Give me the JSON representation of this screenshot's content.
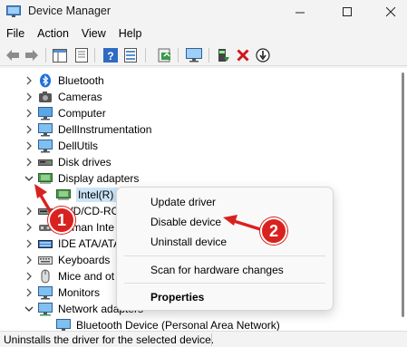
{
  "window": {
    "title": "Device Manager",
    "minimize_glyph": "—",
    "maximize_glyph": "☐",
    "close_glyph": "✕"
  },
  "menu": [
    "File",
    "Action",
    "View",
    "Help"
  ],
  "toolbar": {
    "icons": [
      "back-icon",
      "forward-icon",
      "show-hide-tree-icon",
      "properties-icon",
      "help-icon",
      "scan-hardware-icon",
      "monitor-icon",
      "update-driver-icon",
      "uninstall-icon",
      "disable-icon"
    ]
  },
  "tree": {
    "items": [
      {
        "label": "Bluetooth",
        "icon": "bluetooth-icon",
        "expanded": false
      },
      {
        "label": "Cameras",
        "icon": "camera-icon",
        "expanded": false
      },
      {
        "label": "Computer",
        "icon": "computer-icon",
        "expanded": false
      },
      {
        "label": "DellInstrumentation",
        "icon": "monitor-icon",
        "expanded": false
      },
      {
        "label": "DellUtils",
        "icon": "monitor-icon",
        "expanded": false
      },
      {
        "label": "Disk drives",
        "icon": "disk-drive-icon",
        "expanded": false
      },
      {
        "label": "Display adapters",
        "icon": "display-adapter-icon",
        "expanded": true
      },
      {
        "label": "Intel(R) H",
        "icon": "display-adapter-icon",
        "child": true,
        "selected": true
      },
      {
        "label": "DVD/CD-RO",
        "icon": "dvd-icon",
        "expanded": false
      },
      {
        "label": "Human Inte",
        "icon": "hid-icon",
        "expanded": false
      },
      {
        "label": "IDE ATA/ATA",
        "icon": "ide-icon",
        "expanded": false
      },
      {
        "label": "Keyboards",
        "icon": "keyboard-icon",
        "expanded": false
      },
      {
        "label": "Mice and ot",
        "icon": "mouse-icon",
        "expanded": false
      },
      {
        "label": "Monitors",
        "icon": "monitor-icon",
        "expanded": false
      },
      {
        "label": "Network adapters",
        "icon": "network-icon",
        "expanded": true
      },
      {
        "label": "Bluetooth Device (Personal Area Network)",
        "icon": "network-icon",
        "child": true
      }
    ]
  },
  "context_menu": {
    "items": [
      "Update driver",
      "Disable device",
      "Uninstall device",
      "Scan for hardware changes",
      "Properties"
    ]
  },
  "annotations": {
    "badge_1": "1",
    "badge_2": "2",
    "color": "#d9221f"
  },
  "status": {
    "text": "Uninstalls the driver for the selected device."
  }
}
